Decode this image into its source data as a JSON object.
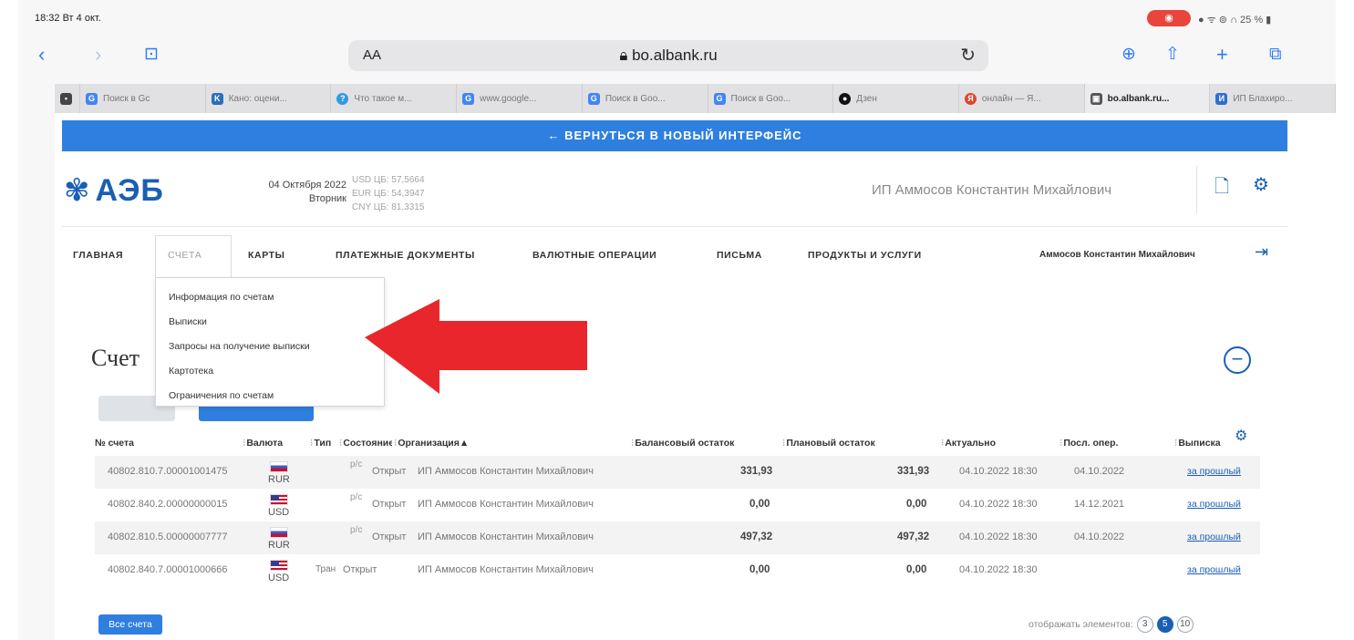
{
  "status_bar": {
    "time": "18:32  Вт 4 окт.",
    "battery": "25 %"
  },
  "browser": {
    "text_size": "AA",
    "url": "bo.albank.ru"
  },
  "tabs": [
    {
      "label": "Поиск в Gc",
      "color": "#4285f4",
      "icon": "G"
    },
    {
      "label": "Кано: оцени...",
      "color": "#2a6ebb",
      "icon": "K"
    },
    {
      "label": "Что такое м...",
      "color": "#2f9be0",
      "icon": "?"
    },
    {
      "label": "www.google...",
      "color": "#4285f4",
      "icon": "G"
    },
    {
      "label": "Поиск в Goo...",
      "color": "#4285f4",
      "icon": "G"
    },
    {
      "label": "Поиск в Goo...",
      "color": "#4285f4",
      "icon": "G"
    },
    {
      "label": "Дзен",
      "color": "#111111",
      "icon": "●"
    },
    {
      "label": "онлайн — Я...",
      "color": "#e0452e",
      "icon": "Я"
    },
    {
      "label": "bo.albank.ru...",
      "color": "#555555",
      "icon": "▣"
    },
    {
      "label": "ИП Блахиро...",
      "color": "#2f6fd0",
      "icon": "И"
    }
  ],
  "banner": "← ВЕРНУТЬСЯ В НОВЫЙ ИНТЕРФЕЙС",
  "header": {
    "logo": "АЭБ",
    "date": "04 Октября 2022",
    "weekday": "Вторник",
    "rates": [
      "USD ЦБ: 57,5664",
      "EUR ЦБ: 54,3947",
      "CNY ЦБ: 81,3315"
    ],
    "company": "ИП Аммосов Константин Михайлович"
  },
  "nav": {
    "items": [
      "ГЛАВНАЯ",
      "СЧЕТА",
      "КАРТЫ",
      "ПЛАТЕЖНЫЕ ДОКУМЕНТЫ",
      "ВАЛЮТНЫЕ ОПЕРАЦИИ",
      "ПИСЬМА",
      "ПРОДУКТЫ И УСЛУГИ"
    ],
    "user": "Аммосов Константин Михайлович"
  },
  "dropdown": [
    "Информация по счетам",
    "Выписки",
    "Запросы на получение выписки",
    "Картотека",
    "Ограничения по счетам"
  ],
  "page_title": "Счет",
  "table": {
    "headers": [
      "№ счета",
      "Валюта",
      "Тип",
      "Состояние",
      "Организация▲",
      "Балансовый остаток",
      "Плановый остаток",
      "Актуально",
      "Посл. опер.",
      "Выписка"
    ],
    "rows": [
      {
        "account": "40802.810.7.00001001475",
        "currency": "RUR",
        "flag": "rur",
        "type": "р/с",
        "state": "Открыт",
        "org": "ИП Аммосов Константин Михайлович",
        "balance": "331,93",
        "planned": "331,93",
        "actual": "04.10.2022 18:30",
        "last_op": "04.10.2022",
        "statement": "за прошлый"
      },
      {
        "account": "40802.840.2.00000000015",
        "currency": "USD",
        "flag": "usd",
        "type": "р/с",
        "state": "Открыт",
        "org": "ИП Аммосов Константин Михайлович",
        "balance": "0,00",
        "planned": "0,00",
        "actual": "04.10.2022 18:30",
        "last_op": "14.12.2021",
        "statement": "за прошлый"
      },
      {
        "account": "40802.810.5.00000007777",
        "currency": "RUR",
        "flag": "rur",
        "type": "р/с",
        "state": "Открыт",
        "org": "ИП Аммосов Константин Михайлович",
        "balance": "497,32",
        "planned": "497,32",
        "actual": "04.10.2022 18:30",
        "last_op": "04.10.2022",
        "statement": "за прошлый"
      },
      {
        "account": "40802.840.7.00001000666",
        "currency": "USD",
        "flag": "usd",
        "type": "Тран",
        "state": "Открыт",
        "org": "ИП Аммосов Константин Михайлович",
        "balance": "0,00",
        "planned": "0,00",
        "actual": "04.10.2022 18:30",
        "last_op": "",
        "statement": "за прошлый"
      }
    ]
  },
  "all_accounts": "Все счета",
  "pager": {
    "label": "отображать элементов:",
    "options": [
      "3",
      "5",
      "10"
    ],
    "active": "5"
  },
  "colors": {
    "accent": "#2f7fe0",
    "brand": "#1a5fb4",
    "arrow": "#e8262b"
  }
}
